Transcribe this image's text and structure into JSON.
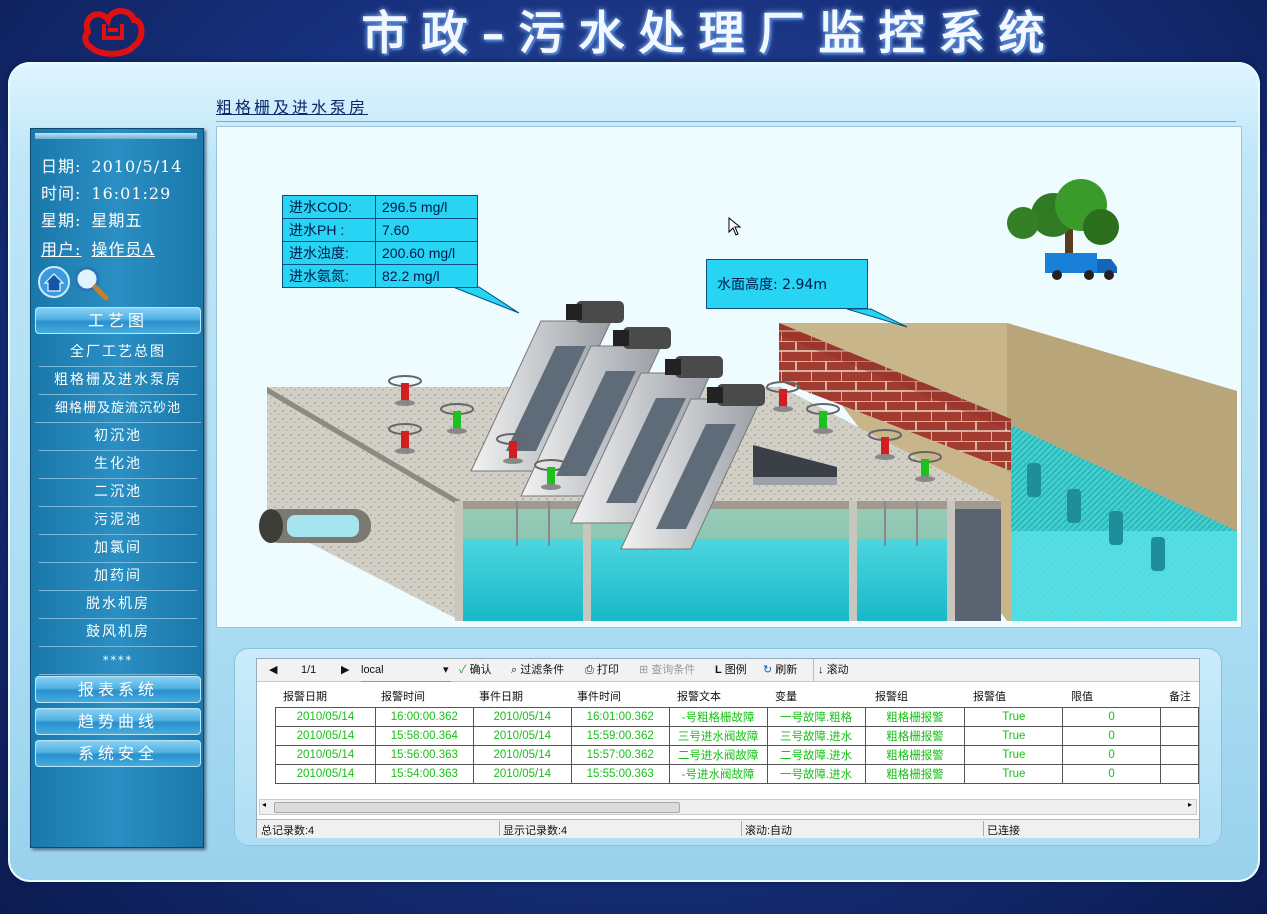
{
  "header": {
    "title": "市政–污水处理厂监控系统"
  },
  "breadcrumb": "粗格栅及进水泵房",
  "info": {
    "date_label": "日期:",
    "date": "2010/5/14",
    "time_label": "时间:",
    "time": "16:01:29",
    "weekday_label": "星期:",
    "weekday": "星期五",
    "user_label": "用户:",
    "user": "操作员A"
  },
  "sidebar": {
    "section_process": "工艺图",
    "menu": [
      "全厂工艺总图",
      "粗格栅及进水泵房",
      "细格栅及旋流沉砂池",
      "初沉池",
      "生化池",
      "二沉池",
      "污泥池",
      "加氯间",
      "加药间",
      "脱水机房",
      "鼓风机房",
      "****"
    ],
    "section_report": "报表系统",
    "section_trend": "趋势曲线",
    "section_security": "系统安全"
  },
  "quality": {
    "rows": [
      {
        "label": "进水COD:",
        "value": "296.5 mg/l"
      },
      {
        "label": "进水PH  :",
        "value": "7.60"
      },
      {
        "label": "进水浊度:",
        "value": "200.60 mg/l"
      },
      {
        "label": "进水氨氮:",
        "value": "82.2 mg/l"
      }
    ]
  },
  "water_level": {
    "text": "水面高度: 2.94m"
  },
  "alarm": {
    "toolbar": {
      "page": "1/1",
      "source": "local",
      "confirm": "确认",
      "filter": "过滤条件",
      "print": "打印",
      "query": "查询条件",
      "legend": "图例",
      "refresh": "刷新",
      "scroll": "滚动"
    },
    "columns": [
      "报警日期",
      "报警时间",
      "事件日期",
      "事件时间",
      "报警文本",
      "变量",
      "报警组",
      "报警值",
      "限值",
      "备注"
    ],
    "rows": [
      [
        "2010/05/14",
        "16:00:00.362",
        "2010/05/14",
        "16:01:00.362",
        "-号粗格栅故障",
        "一号故障.粗格",
        "粗格栅报警",
        "True",
        "0"
      ],
      [
        "2010/05/14",
        "15:58:00.364",
        "2010/05/14",
        "15:59:00.362",
        "三号进水阀故障",
        "三号故障.进水",
        "粗格栅报警",
        "True",
        "0"
      ],
      [
        "2010/05/14",
        "15:56:00.363",
        "2010/05/14",
        "15:57:00.362",
        "二号进水阀故障",
        "二号故障.进水",
        "粗格栅报警",
        "True",
        "0"
      ],
      [
        "2010/05/14",
        "15:54:00.363",
        "2010/05/14",
        "15:55:00.363",
        "-号进水阀故障",
        "一号故障.进水",
        "粗格栅报警",
        "True",
        "0"
      ]
    ],
    "status": {
      "total": "总记录数:4",
      "shown": "显示记录数:4",
      "scroll_mode": "滚动:自动",
      "connection": "已连接"
    }
  },
  "colors": {
    "panel": "#a9dcf2",
    "sidebar": "#2a8fc3",
    "alarm_text": "#16c016",
    "callout": "#28d4f4"
  },
  "icons": [
    "logo-emblem",
    "home-icon",
    "zoom-icon",
    "tree-icon",
    "truck-icon",
    "cursor-icon",
    "valve-icon",
    "pump-motor-icon"
  ]
}
